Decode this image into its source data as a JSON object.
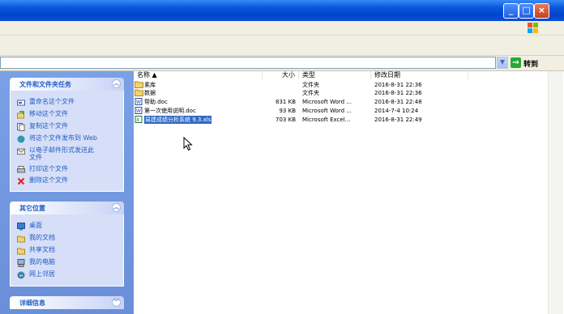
{
  "address_bar": {
    "go_label": "转到"
  },
  "task_pane": {
    "file_tasks": {
      "title": "文件和文件夹任务",
      "items": [
        {
          "label": "重命名这个文件",
          "icon": "rename-icon"
        },
        {
          "label": "移动这个文件",
          "icon": "move-icon"
        },
        {
          "label": "复制这个文件",
          "icon": "copy-icon"
        },
        {
          "label": "将这个文件发布到 Web",
          "icon": "globe-icon"
        },
        {
          "label": "以电子邮件形式发送此",
          "label2": "文件",
          "icon": "email-icon"
        },
        {
          "label": "打印这个文件",
          "icon": "printer-icon"
        },
        {
          "label": "删除这个文件",
          "icon": "delete-icon"
        }
      ]
    },
    "other_places": {
      "title": "其它位置",
      "items": [
        {
          "label": "桌面",
          "icon": "desktop-icon"
        },
        {
          "label": "我的文档",
          "icon": "folder-icon"
        },
        {
          "label": "共享文档",
          "icon": "folder-icon"
        },
        {
          "label": "我的电脑",
          "icon": "computer-icon"
        },
        {
          "label": "网上邻居",
          "icon": "network-icon"
        }
      ]
    },
    "details": {
      "title": "详细信息"
    }
  },
  "columns": {
    "name": "名称 ▲",
    "size": "大小",
    "type": "类型",
    "modified": "修改日期"
  },
  "files": [
    {
      "name": "素库",
      "size": "",
      "type": "文件夹",
      "modified": "2016-8-31 22:36",
      "icon": "folder"
    },
    {
      "name": "数据",
      "size": "",
      "type": "文件夹",
      "modified": "2016-8-31 22:36",
      "icon": "folder"
    },
    {
      "name": "帮助.doc",
      "size": "831 KB",
      "type": "Microsoft Word ...",
      "modified": "2016-8-31 22:48",
      "icon": "word"
    },
    {
      "name": "第一次使用说明.doc",
      "size": "93 KB",
      "type": "Microsoft Word ...",
      "modified": "2014-7-4 10:24",
      "icon": "word"
    },
    {
      "name": "易建成绩分析系统 9.3.xls",
      "size": "703 KB",
      "type": "Microsoft Excel...",
      "modified": "2016-8-31 22:49",
      "icon": "excel",
      "selected": true
    }
  ],
  "colors": {
    "task_link": "#215dc6",
    "selection": "#316ac5",
    "title_bar": "#0a58e0"
  }
}
